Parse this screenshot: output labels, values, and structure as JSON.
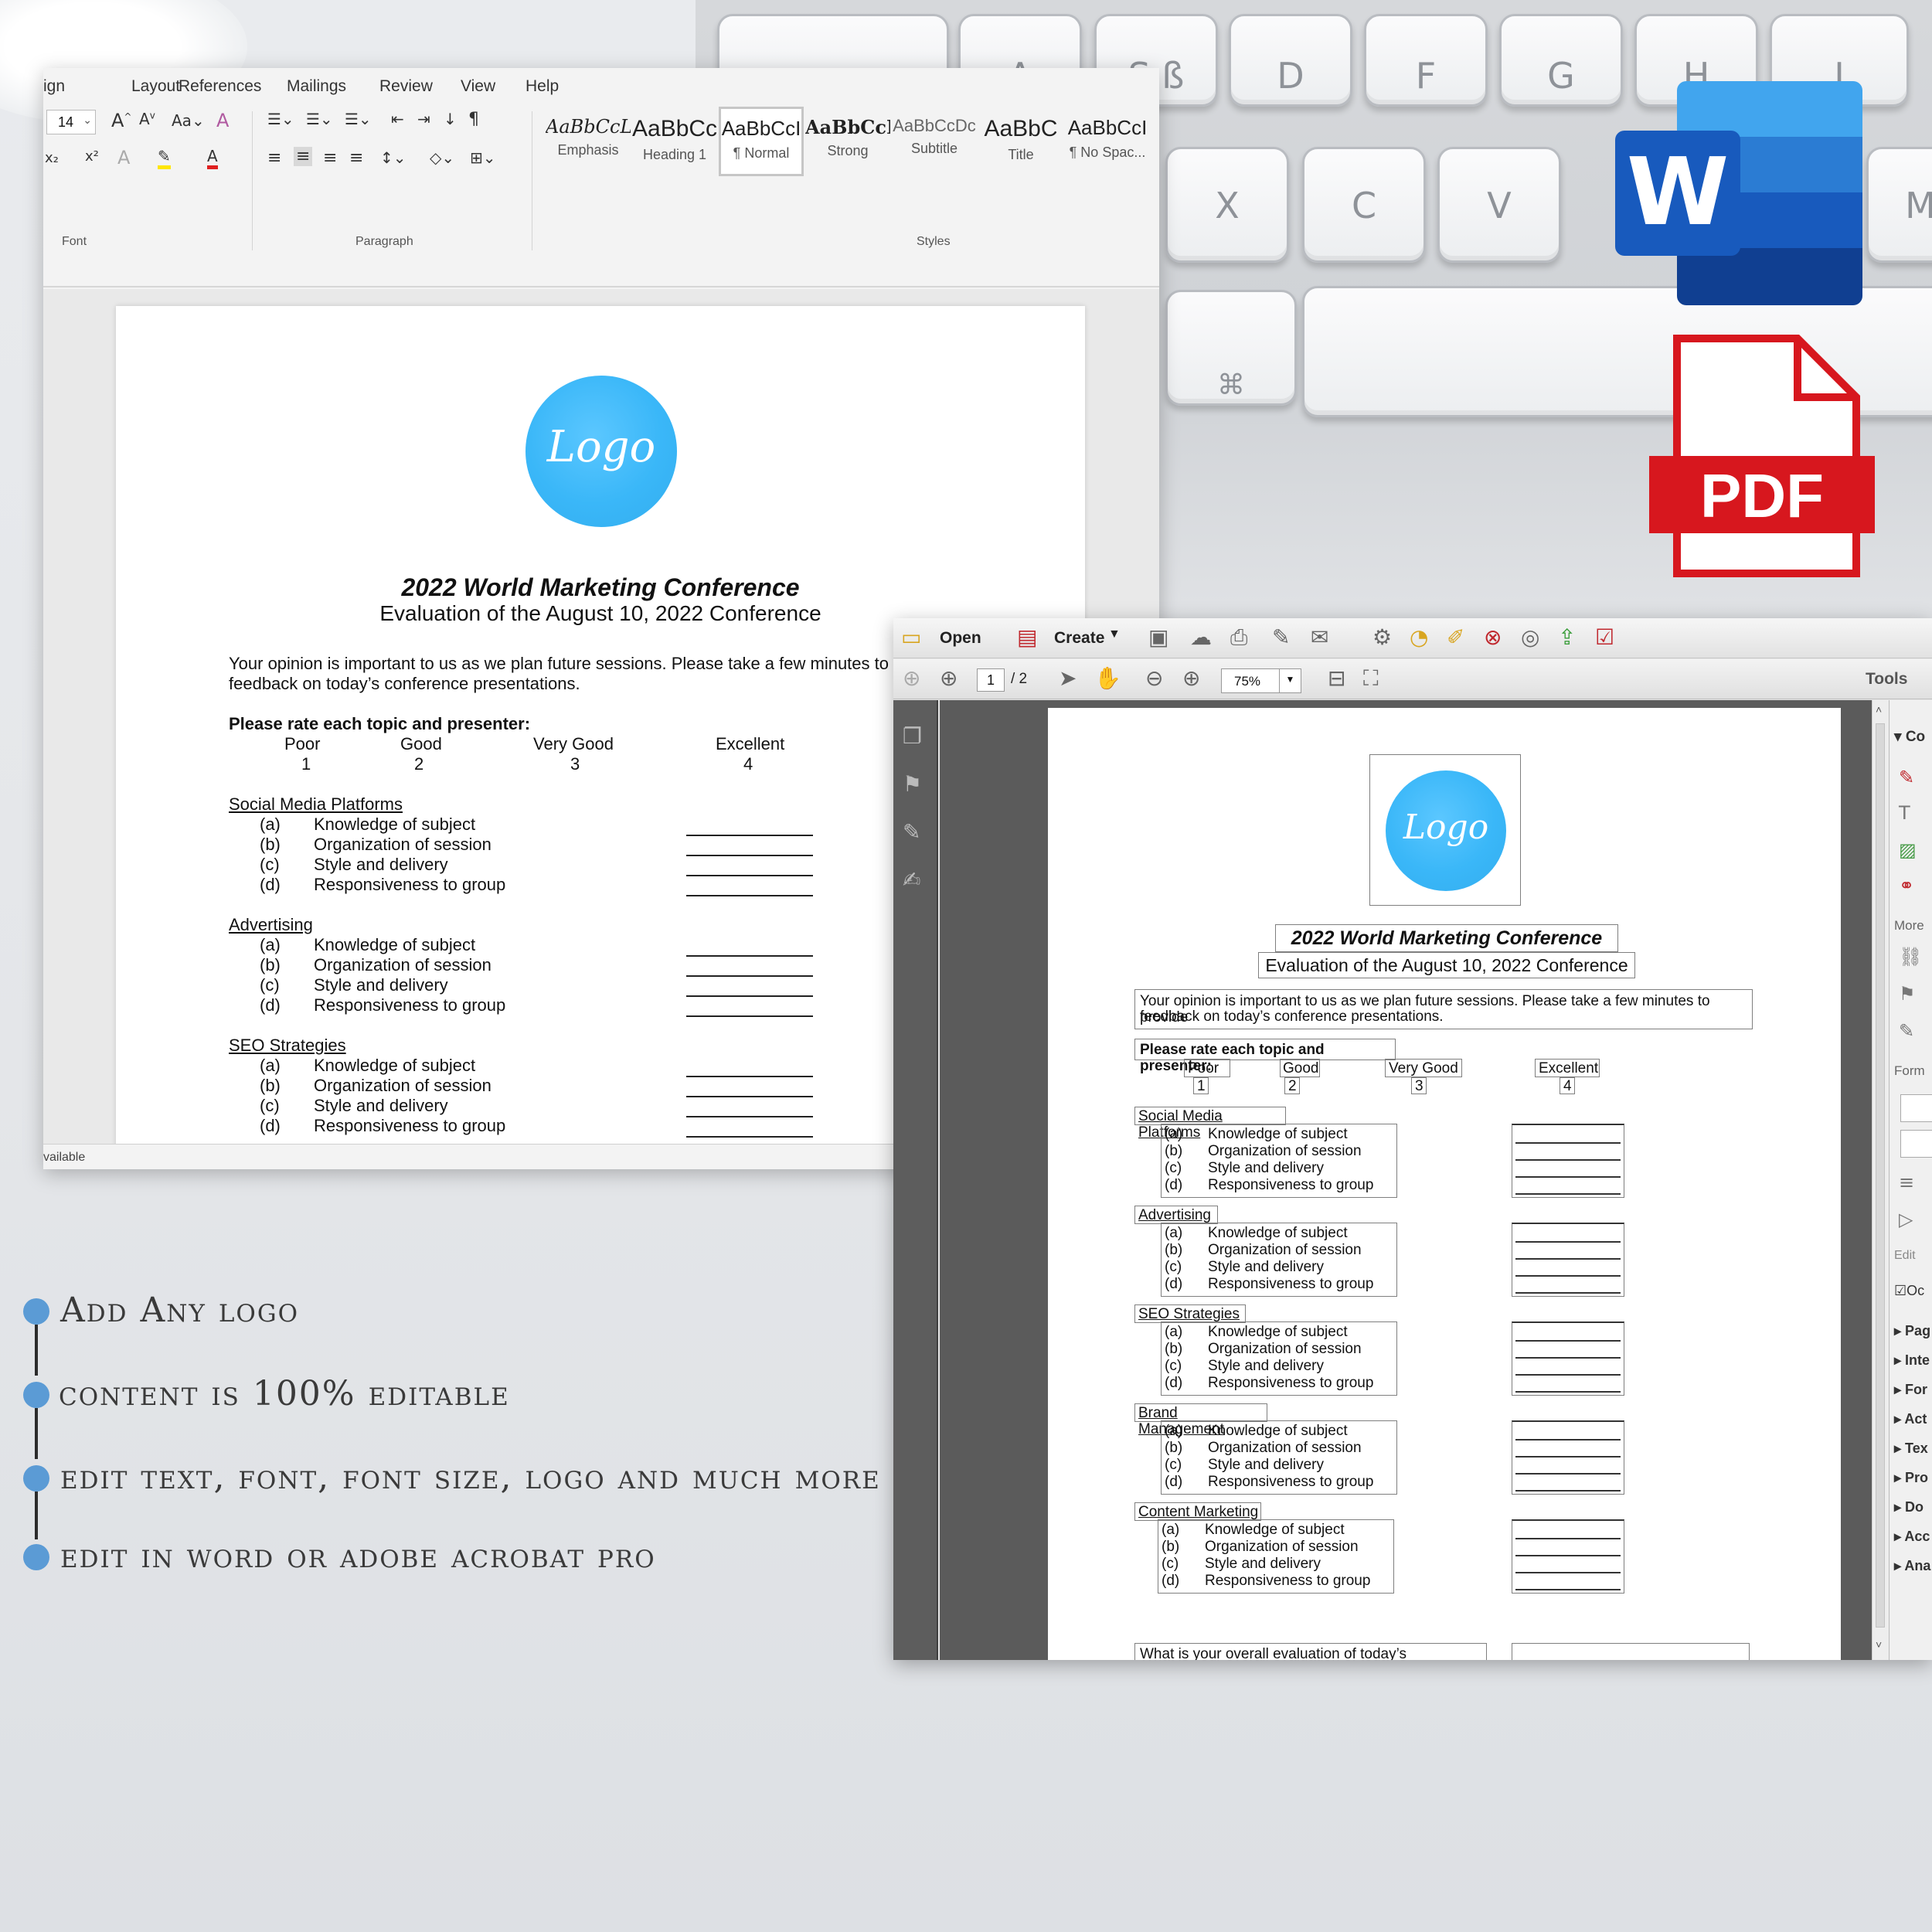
{
  "word": {
    "menu": [
      "ign",
      "Layout",
      "References",
      "Mailings",
      "Review",
      "View",
      "Help"
    ],
    "font_size": "14",
    "groups": {
      "font": "Font",
      "paragraph": "Paragraph",
      "styles": "Styles"
    },
    "styles": [
      {
        "sample": "AaBbCcL",
        "name": "Emphasis"
      },
      {
        "sample": "AaBbCc",
        "name": "Heading 1"
      },
      {
        "sample": "AaBbCcI",
        "name": "¶ Normal"
      },
      {
        "sample": "AaBbCcI",
        "name": "Strong"
      },
      {
        "sample": "AaBbCcDc",
        "name": "Subtitle"
      },
      {
        "sample": "AaBbC",
        "name": "Title"
      },
      {
        "sample": "AaBbCcI",
        "name": "¶ No Spac..."
      }
    ],
    "status": "vailable"
  },
  "doc": {
    "logo_text": "Logo",
    "title": "2022 World Marketing Conference",
    "subtitle": "Evaluation of the August 10, 2022 Conference",
    "intro_line1": "Your opinion is important to us as we plan future sessions. Please take a few minutes to provide",
    "intro_line2": "feedback on today’s conference presentations.",
    "rate_heading": "Please rate each topic and presenter:",
    "scale": [
      {
        "label": "Poor",
        "num": "1"
      },
      {
        "label": "Good",
        "num": "2"
      },
      {
        "label": "Very Good",
        "num": "3"
      },
      {
        "label": "Excellent",
        "num": "4"
      }
    ],
    "sections": [
      {
        "name": "Social Media Platforms"
      },
      {
        "name": "Advertising"
      },
      {
        "name": "SEO Strategies"
      },
      {
        "name": "Brand Management"
      },
      {
        "name": "Content Marketing"
      }
    ],
    "items": [
      {
        "letter": "(a)",
        "text": "Knowledge of subject"
      },
      {
        "letter": "(b)",
        "text": "Organization of session"
      },
      {
        "letter": "(c)",
        "text": "Style and delivery"
      },
      {
        "letter": "(d)",
        "text": "Responsiveness to group"
      }
    ],
    "overall_question": "What is your overall evaluation of today’s conference?"
  },
  "acrobat": {
    "open": "Open",
    "create": "Create",
    "page_current": "1",
    "page_total": "/ 2",
    "zoom": "75%",
    "tools": "Tools",
    "right_panel": [
      "Co",
      "More",
      "Form",
      "Edit",
      "Oc",
      "Pag",
      "Inte",
      "For",
      "Act",
      "Tex",
      "Pro",
      "Do",
      "Acc",
      "Ana"
    ]
  },
  "icons": {
    "word_letter": "W",
    "pdf_label": "PDF"
  },
  "features": [
    "Add Any logo",
    "content is 100% editable",
    "edit text, font, font size, logo and much more",
    " edit in word or adobe acrobat pro"
  ],
  "colors": {
    "logo_blue": "#38b3f5",
    "word_blue": "#2b579a",
    "pdf_red": "#d7171e",
    "bullet": "#5b9bd5"
  }
}
